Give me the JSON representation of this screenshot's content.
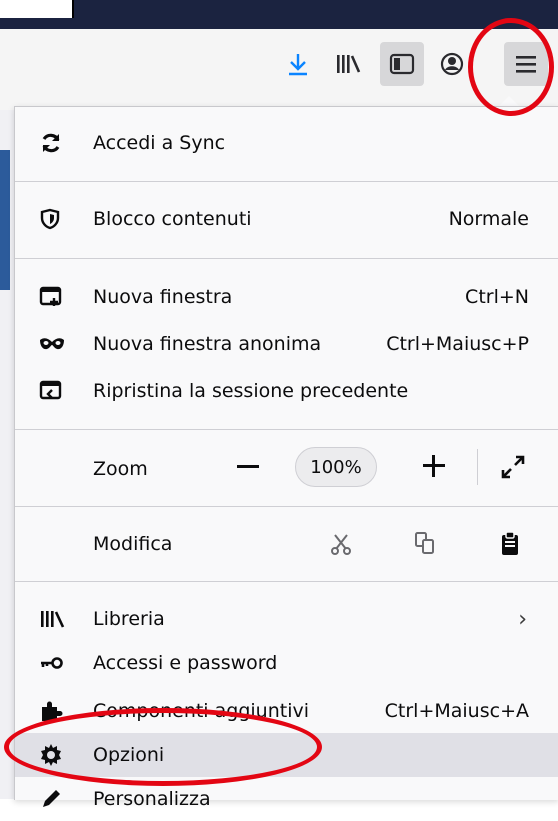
{
  "toolbar": {
    "icons": [
      "download-icon",
      "library-icon",
      "sidebar-icon",
      "account-icon",
      "hamburger-menu-icon"
    ]
  },
  "menu": {
    "sync": {
      "label": "Accedi a Sync",
      "icon": "sync-icon"
    },
    "content_blocking": {
      "label": "Blocco contenuti",
      "value": "Normale",
      "icon": "shield-icon"
    },
    "new_window": {
      "label": "Nuova finestra",
      "shortcut": "Ctrl+N",
      "icon": "new-window-icon"
    },
    "private_window": {
      "label": "Nuova finestra anonima",
      "shortcut": "Ctrl+Maiusc+P",
      "icon": "mask-icon"
    },
    "restore_session": {
      "label": "Ripristina la sessione precedente",
      "icon": "restore-session-icon"
    },
    "zoom": {
      "label": "Zoom",
      "level": "100%"
    },
    "edit": {
      "label": "Modifica"
    },
    "library": {
      "label": "Libreria",
      "icon": "library-icon"
    },
    "logins": {
      "label": "Accessi e password",
      "icon": "key-icon"
    },
    "addons": {
      "label": "Componenti aggiuntivi",
      "shortcut": "Ctrl+Maiusc+A",
      "icon": "puzzle-icon"
    },
    "options": {
      "label": "Opzioni",
      "icon": "gear-icon"
    },
    "customize": {
      "label": "Personalizza",
      "icon": "pencil-icon"
    }
  },
  "colors": {
    "annotation": "#e30613",
    "download_accent": "#0a84ff",
    "titlebar": "#1b2340"
  }
}
